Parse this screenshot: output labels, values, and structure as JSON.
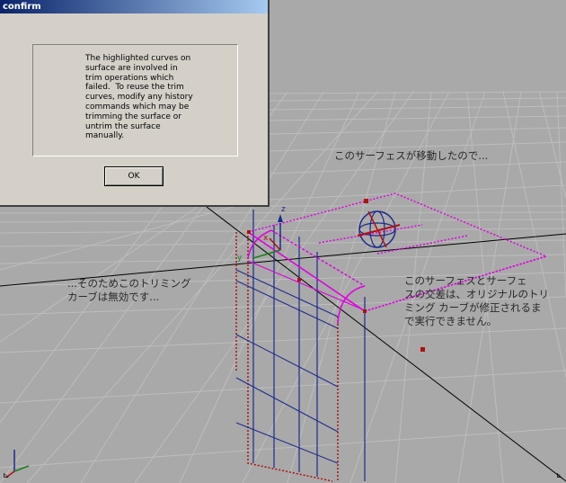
{
  "dialog": {
    "title": "confirm",
    "message": "The highlighted curves on\nsurface are involved in\ntrim operations which\nfailed.  To reuse the trim\ncurves, modify any history\ncommands which may be\ntrimming the surface or\nuntrim the surface\nmanually.",
    "ok_label": "OK"
  },
  "annotations": {
    "surface_moved": "このサーフェスが移動したので...",
    "trim_invalid": "...そのためこのトリミング\nカーブは無効です...",
    "intersection": "このサーフェスとサーフェ\nスの交差は、オリジナルのトリ\nミング カーブが修正されるま\nで実行できません。"
  },
  "viewport": {
    "axis_z_label": "z",
    "axis_x_label": "x",
    "axis_y_label": "y",
    "colors": {
      "background": "#a9a9a9",
      "grid": "#bdbdbd",
      "highlight": "#e000e0",
      "curve": "#1c2a8c",
      "dotted": "#b01010"
    }
  }
}
